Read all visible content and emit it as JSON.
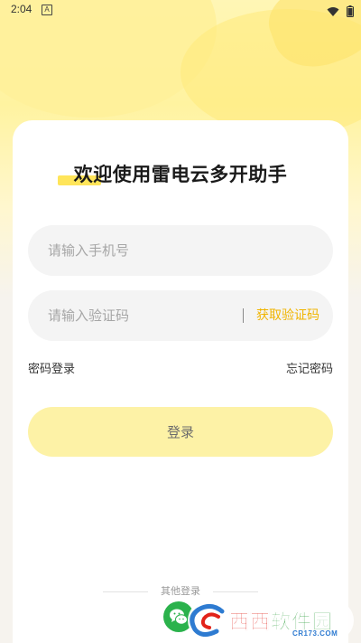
{
  "status_bar": {
    "time": "2:04",
    "app_icon_glyph": "A",
    "icons": [
      "notification-app-icon",
      "wifi-icon",
      "battery-icon"
    ]
  },
  "login": {
    "title": "欢迎使用雷电云多开助手",
    "phone_placeholder": "请输入手机号",
    "code_placeholder": "请输入验证码",
    "get_code_label": "获取验证码",
    "password_login_label": "密码登录",
    "forgot_password_label": "忘记密码",
    "login_button_label": "登录",
    "other_login_label": "其他登录",
    "other_login_icons": [
      "wechat-icon"
    ]
  },
  "watermark": {
    "brand_red": "西西",
    "brand_green": "软件园",
    "sub": "CR173.COM"
  },
  "colors": {
    "accent_yellow": "#ffe55a",
    "get_code_text": "#f0b400",
    "login_button_bg": "#fdf2a6",
    "wechat_green": "#2bb24c"
  }
}
